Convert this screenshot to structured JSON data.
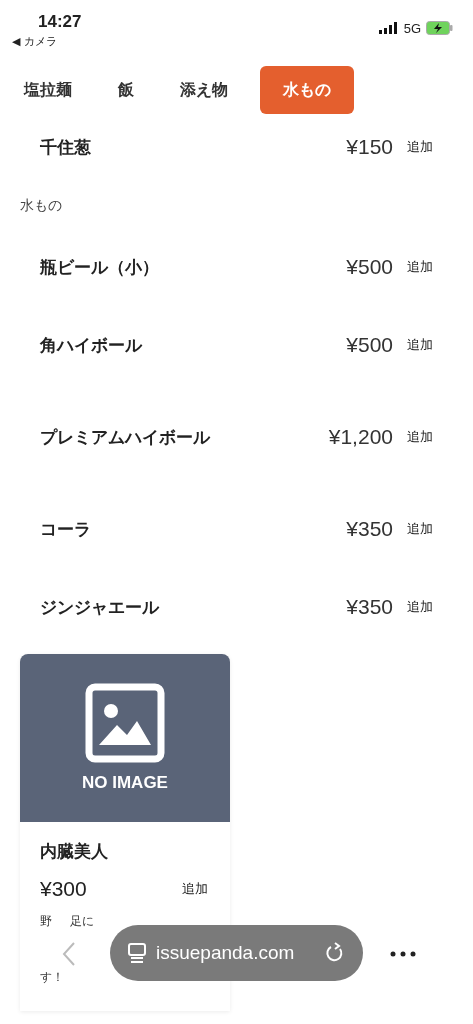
{
  "status_bar": {
    "time": "14:27",
    "back_label": "◀ カメラ",
    "network": "5G"
  },
  "tabs": [
    {
      "label": "塩拉麺",
      "selected": false
    },
    {
      "label": "飯",
      "selected": false
    },
    {
      "label": "添え物",
      "selected": false
    },
    {
      "label": "水もの",
      "selected": true
    }
  ],
  "prev_items": [
    {
      "name": "千住葱",
      "price": "¥150",
      "add": "追加"
    }
  ],
  "section": {
    "title": "水もの",
    "items": [
      {
        "name": "瓶ビール（小）",
        "price": "¥500",
        "add": "追加"
      },
      {
        "name": "角ハイボール",
        "price": "¥500",
        "add": "追加"
      },
      {
        "name": "プレミアムハイボール",
        "price": "¥1,200",
        "add": "追加"
      },
      {
        "name": "コーラ",
        "price": "¥350",
        "add": "追加"
      },
      {
        "name": "ジンジャエール",
        "price": "¥350",
        "add": "追加"
      }
    ]
  },
  "card": {
    "image_label": "NO IMAGE",
    "name": "内臓美人",
    "price": "¥300",
    "add": "追加",
    "description_fragments": [
      "野",
      "足に",
      "す！"
    ]
  },
  "browser_bar": {
    "url": "issuepanda.com"
  }
}
